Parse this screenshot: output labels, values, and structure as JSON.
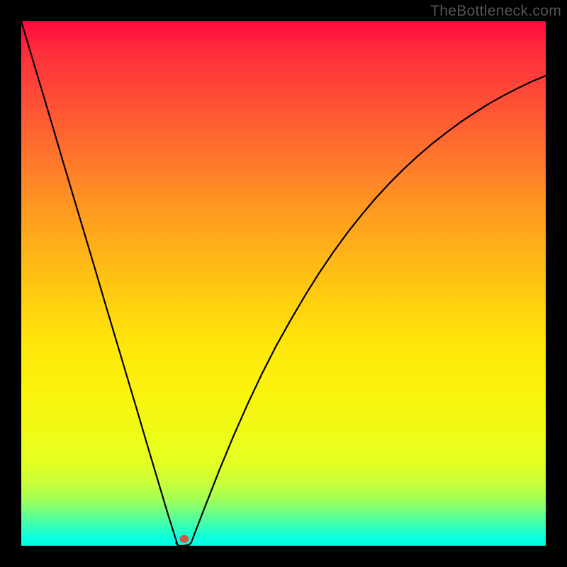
{
  "watermark": "TheBottleneck.com",
  "marker": {
    "color": "#cc5a44",
    "x_frac": 0.3108,
    "y_frac": 0.987
  },
  "chart_data": {
    "type": "line",
    "title": "",
    "xlabel": "",
    "ylabel": "",
    "xlim": [
      0,
      1
    ],
    "ylim": [
      0,
      1
    ],
    "grid": false,
    "series": [
      {
        "name": "left-branch",
        "x": [
          0.0,
          0.02,
          0.04,
          0.06,
          0.08,
          0.1,
          0.12,
          0.14,
          0.16,
          0.18,
          0.2,
          0.22,
          0.24,
          0.26,
          0.28,
          0.297
        ],
        "y": [
          1.0,
          0.933,
          0.866,
          0.799,
          0.731,
          0.664,
          0.597,
          0.53,
          0.462,
          0.395,
          0.328,
          0.261,
          0.193,
          0.126,
          0.059,
          0.005
        ]
      },
      {
        "name": "right-branch",
        "x": [
          0.324,
          0.337,
          0.351,
          0.378,
          0.405,
          0.432,
          0.459,
          0.486,
          0.514,
          0.541,
          0.568,
          0.595,
          0.622,
          0.649,
          0.676,
          0.703,
          0.73,
          0.757,
          0.784,
          0.811,
          0.838,
          0.865,
          0.892,
          0.919,
          0.946,
          0.973,
          1.0
        ],
        "y": [
          0.006,
          0.04,
          0.076,
          0.145,
          0.21,
          0.271,
          0.328,
          0.381,
          0.431,
          0.477,
          0.52,
          0.56,
          0.597,
          0.631,
          0.663,
          0.692,
          0.719,
          0.744,
          0.767,
          0.788,
          0.808,
          0.826,
          0.843,
          0.858,
          0.872,
          0.885,
          0.896
        ]
      },
      {
        "name": "bottom-bridge",
        "x": [
          0.295,
          0.3,
          0.31,
          0.32,
          0.324
        ],
        "y": [
          0.005,
          0.0,
          0.0,
          0.002,
          0.006
        ]
      }
    ],
    "annotations": []
  }
}
